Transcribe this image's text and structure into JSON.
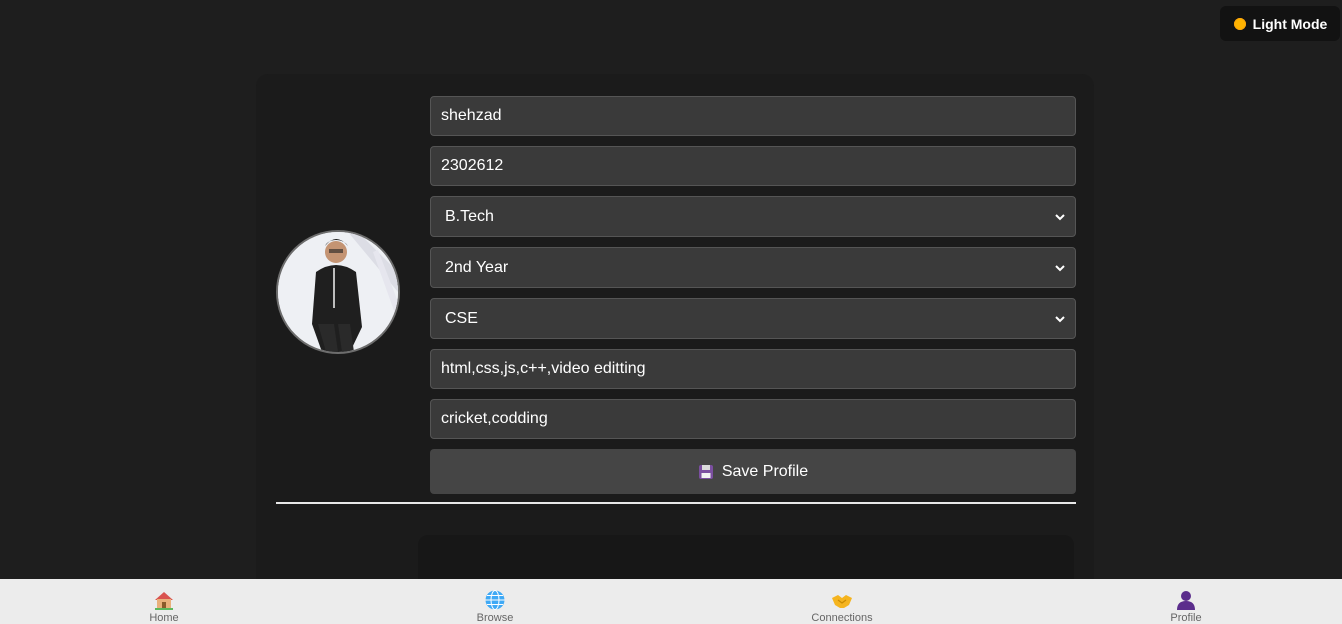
{
  "theme_toggle": {
    "label": "Light Mode",
    "icon": "sun-icon"
  },
  "profile": {
    "name_value": "shehzad",
    "id_value": "2302612",
    "course_selected": "B.Tech",
    "year_selected": "2nd Year",
    "branch_selected": "CSE",
    "skills_value": "html,css,js,c++,video editting",
    "hobbies_value": "cricket,codding",
    "save_label": "Save Profile"
  },
  "bottom_nav": [
    {
      "label": "Home",
      "icon": "home-icon"
    },
    {
      "label": "Browse",
      "icon": "globe-icon"
    },
    {
      "label": "Connections",
      "icon": "handshake-icon"
    },
    {
      "label": "Profile",
      "icon": "user-icon"
    }
  ],
  "colors": {
    "background": "#1e1e1e",
    "field": "#3a3a3a",
    "button": "#454545",
    "nav": "#ececec"
  }
}
